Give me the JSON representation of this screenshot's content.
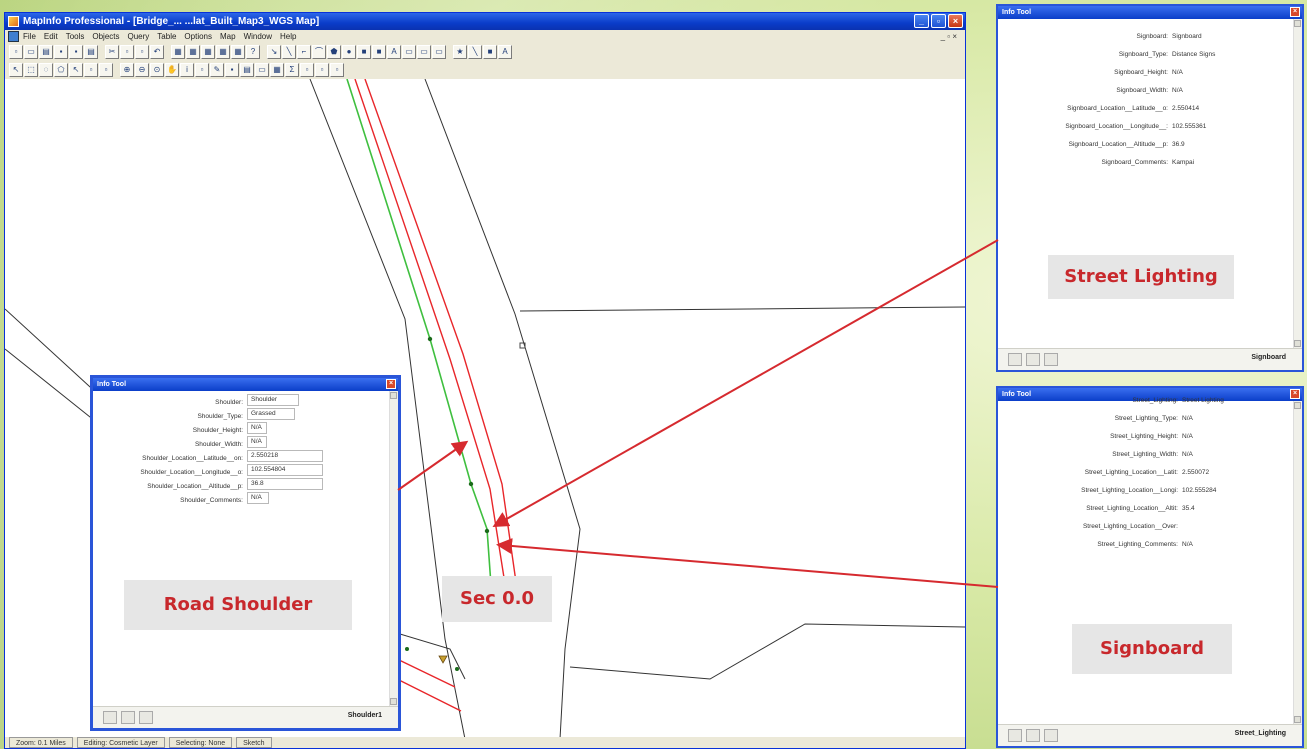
{
  "app": {
    "title": "MapInfo Professional - [Bridge_... ...lat_Built_Map3_WGS Map]",
    "menu": [
      "File",
      "Edit",
      "Tools",
      "Objects",
      "Query",
      "Table",
      "Options",
      "Map",
      "Window",
      "Help"
    ],
    "mdi_controls": "_ ▫ ×",
    "status": [
      "Zoom: 0.1 Miles",
      "Editing: Cosmetic Layer",
      "Selecting: None",
      "Sketch"
    ]
  },
  "shoulder_info": {
    "title": "Info Tool",
    "fields": [
      {
        "label": "Shoulder:",
        "value": "Shoulder"
      },
      {
        "label": "Shoulder_Type:",
        "value": "Grassed"
      },
      {
        "label": "Shoulder_Height:",
        "value": "N/A"
      },
      {
        "label": "Shoulder_Width:",
        "value": "N/A"
      },
      {
        "label": "Shoulder_Location__Latitude__on:",
        "value": "2.550218"
      },
      {
        "label": "Shoulder_Location__Longitude__o:",
        "value": "102.554804"
      },
      {
        "label": "Shoulder_Location__Altitude__p:",
        "value": "36.8"
      },
      {
        "label": "Shoulder_Comments:",
        "value": "N/A"
      }
    ],
    "footer_label": "Shoulder1"
  },
  "signboard_info": {
    "title": "Info Tool",
    "fields": [
      {
        "label": "Signboard:",
        "value": "Signboard"
      },
      {
        "label": "Signboard_Type:",
        "value": "Distance Signs"
      },
      {
        "label": "Signboard_Height:",
        "value": "N/A"
      },
      {
        "label": "Signboard_Width:",
        "value": "N/A"
      },
      {
        "label": "Signboard_Location__Latitude__o:",
        "value": "2.550414"
      },
      {
        "label": "Signboard_Location__Longitude__:",
        "value": "102.555361"
      },
      {
        "label": "Signboard_Location__Altitude__p:",
        "value": "36.9"
      },
      {
        "label": "Signboard_Comments:",
        "value": "Kampai"
      }
    ],
    "footer_label": "Signboard"
  },
  "lighting_info": {
    "title": "Info Tool",
    "fields": [
      {
        "label": "Street_Lighting:",
        "value": "Street Lighting"
      },
      {
        "label": "Street_Lighting_Type:",
        "value": "N/A"
      },
      {
        "label": "Street_Lighting_Height:",
        "value": "N/A"
      },
      {
        "label": "Street_Lighting_Width:",
        "value": "N/A"
      },
      {
        "label": "Street_Lighting_Location__Latit:",
        "value": "2.550072"
      },
      {
        "label": "Street_Lighting_Location__Longi:",
        "value": "102.555284"
      },
      {
        "label": "Street_Lighting_Location__Altit:",
        "value": "35.4"
      },
      {
        "label": "Street_Lighting_Location__Over:",
        "value": ""
      },
      {
        "label": "Street_Lighting_Comments:",
        "value": "N/A"
      }
    ],
    "footer_label": "Street_Lighting"
  },
  "callouts": {
    "road_shoulder": "Road Shoulder",
    "sec": "Sec 0.0",
    "street_lighting": "Street Lighting",
    "signboard": "Signboard"
  },
  "colors": {
    "window_blue": "#2a55d8",
    "road_green": "#3fbf3f",
    "road_red": "#e8262a",
    "arrow_red": "#d62a2f",
    "callout_text": "#c8282c"
  }
}
